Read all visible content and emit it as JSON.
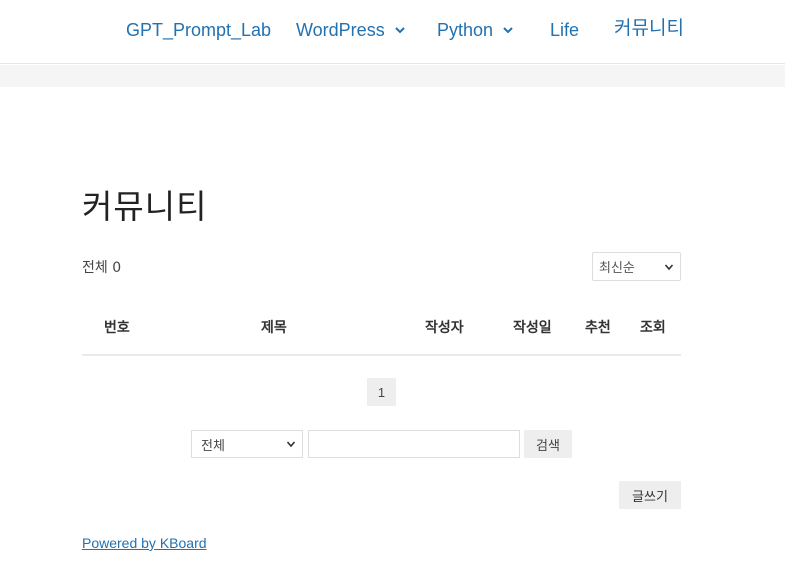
{
  "nav": {
    "items": [
      {
        "label": "GPT_Prompt_Lab",
        "has_dropdown": false
      },
      {
        "label": "WordPress",
        "has_dropdown": true
      },
      {
        "label": "Python",
        "has_dropdown": true
      },
      {
        "label": "Life",
        "has_dropdown": false
      },
      {
        "label": "커뮤니티",
        "has_dropdown": false
      }
    ]
  },
  "board": {
    "title": "커뮤니티",
    "total_label": "전체 0",
    "sort": {
      "selected": "최신순"
    },
    "columns": [
      "번호",
      "제목",
      "작성자",
      "작성일",
      "추천",
      "조회"
    ],
    "pagination": {
      "current": "1"
    },
    "search": {
      "field_selected": "전체",
      "query_value": "",
      "button_label": "검색"
    },
    "write_button_label": "글쓰기",
    "powered_by": "Powered by KBoard"
  },
  "colors": {
    "link": "#2271b1",
    "button_bg": "#eeeeee",
    "band": "#f5f5f5"
  }
}
